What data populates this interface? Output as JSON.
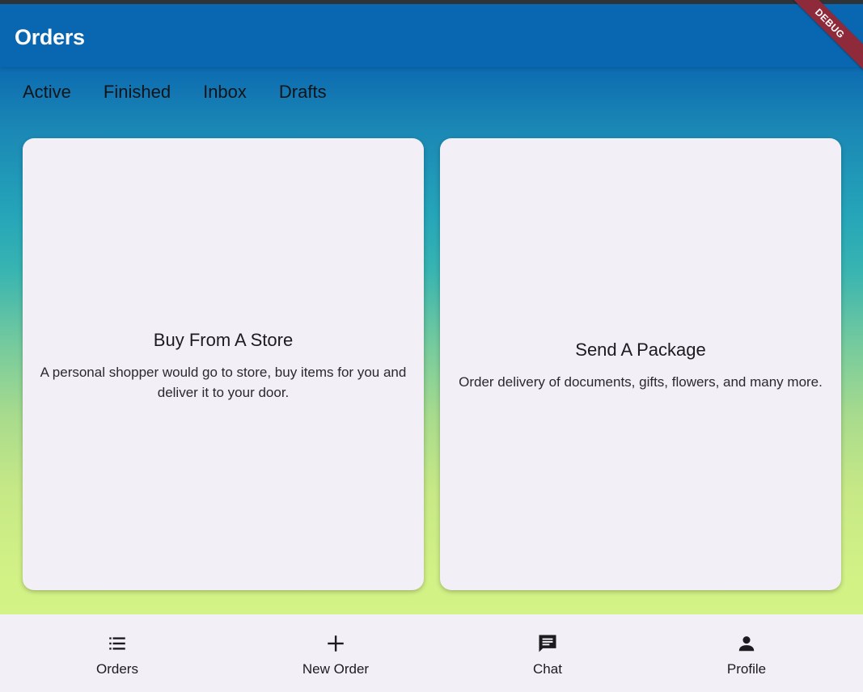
{
  "app_bar": {
    "title": "Orders",
    "debug_banner": "DEBUG"
  },
  "tabs": [
    {
      "label": "Active"
    },
    {
      "label": "Finished"
    },
    {
      "label": "Inbox"
    },
    {
      "label": "Drafts"
    }
  ],
  "cards": [
    {
      "title": "Buy From A Store",
      "description": "A personal shopper would go to store, buy items for you and deliver it to your door."
    },
    {
      "title": "Send A Package",
      "description": "Order delivery of documents, gifts, flowers, and many more."
    }
  ],
  "bottom_nav": {
    "items": [
      {
        "label": "Orders",
        "icon": "list-icon"
      },
      {
        "label": "New Order",
        "icon": "plus-icon"
      },
      {
        "label": "Chat",
        "icon": "chat-icon"
      },
      {
        "label": "Profile",
        "icon": "person-icon"
      }
    ]
  },
  "colors": {
    "app_bar": "#0966b0",
    "gradient_top": "#0a66b0",
    "gradient_mid": "#25a5b9",
    "gradient_bottom": "#d4f386",
    "card_bg": "#f2eff6",
    "debug_banner": "#8e2a3a"
  }
}
